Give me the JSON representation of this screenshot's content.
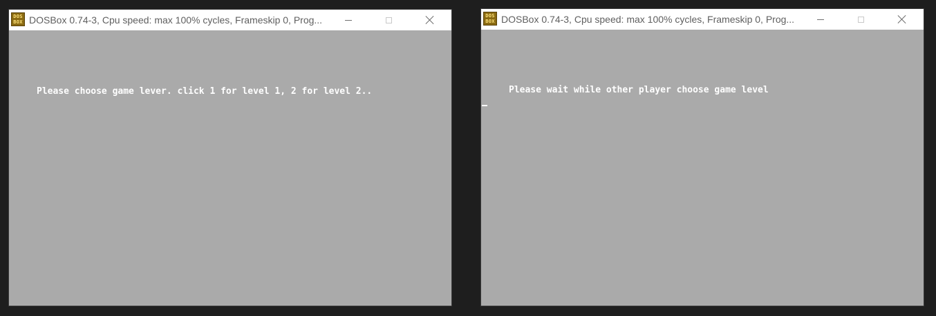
{
  "windows": [
    {
      "title": "DOSBox 0.74-3, Cpu speed: max 100% cycles, Frameskip  0, Prog...",
      "icon_text_top": "DOS",
      "icon_text_bottom": "BOX",
      "screen_text": "Please choose game lever. click 1 for level 1, 2 for level 2.."
    },
    {
      "title": "DOSBox 0.74-3, Cpu speed: max 100% cycles, Frameskip  0, Prog...",
      "icon_text_top": "DOS",
      "icon_text_bottom": "BOX",
      "screen_text": "Please wait while other player choose game level"
    }
  ],
  "colors": {
    "desktop_background": "#1e1e1e",
    "dos_screen": "#aaaaaa",
    "dos_text": "#ffffff",
    "titlebar": "#ffffff",
    "icon_background": "#8a6a12"
  },
  "icons": {
    "app": "dosbox-icon",
    "minimize": "minimize-icon",
    "maximize": "maximize-icon",
    "close": "close-icon"
  }
}
